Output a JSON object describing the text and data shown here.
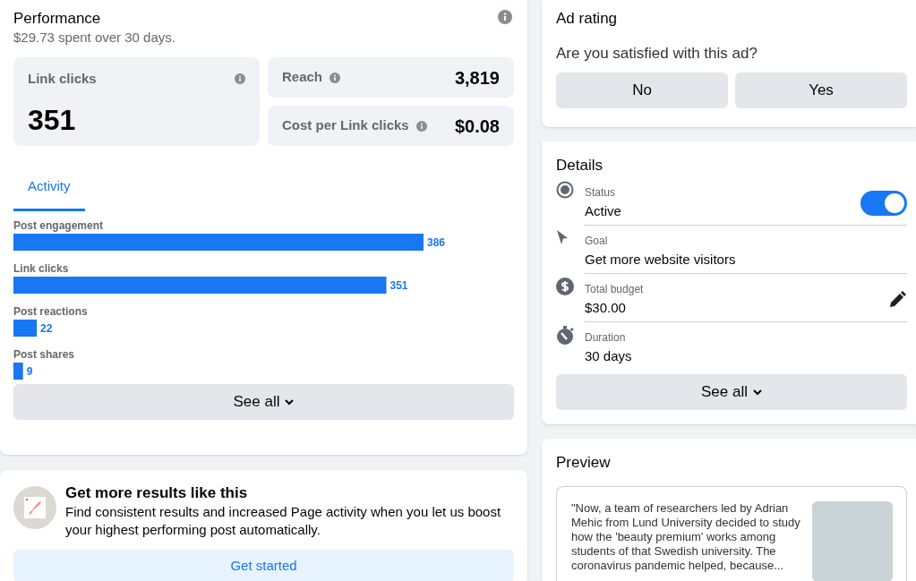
{
  "performance": {
    "title": "Performance",
    "summary": "$29.73 spent over 30 days.",
    "main_metric": {
      "label": "Link clicks",
      "value": "351"
    },
    "metrics": [
      {
        "label": "Reach",
        "value": "3,819"
      },
      {
        "label": "Cost per Link clicks",
        "value": "$0.08"
      }
    ],
    "tabs": [
      {
        "label": "Activity",
        "selected": true
      }
    ],
    "chart_data": {
      "type": "bar",
      "orientation": "horizontal",
      "categories": [
        "Post engagement",
        "Link clicks",
        "Post reactions",
        "Post shares"
      ],
      "values": [
        386,
        351,
        22,
        9
      ],
      "data_labels": true
    },
    "see_all": "See all"
  },
  "promo": {
    "title": "Get more results like this",
    "text": "Find consistent results and increased Page activity when you let us boost your highest performing post automatically.",
    "button": "Get started"
  },
  "ad_rating": {
    "title": "Ad rating",
    "question": "Are you satisfied with this ad?",
    "buttons": [
      "No",
      "Yes"
    ]
  },
  "details": {
    "title": "Details",
    "items": [
      {
        "kind": "status",
        "label": "Status",
        "value": "Active",
        "toggle": {
          "on": true
        }
      },
      {
        "kind": "goal",
        "label": "Goal",
        "value": "Get more website visitors"
      },
      {
        "kind": "budget",
        "label": "Total budget",
        "value": "$30.00",
        "editable": true
      },
      {
        "kind": "duration",
        "label": "Duration",
        "value": "30 days"
      }
    ],
    "see_all": "See all"
  },
  "preview": {
    "title": "Preview",
    "text": "\"Now, a team of researchers led by Adrian Mehic from Lund University decided to study how the 'beauty premium' works among students of that Swedish university. The coronavirus pandemic helped, because..."
  }
}
